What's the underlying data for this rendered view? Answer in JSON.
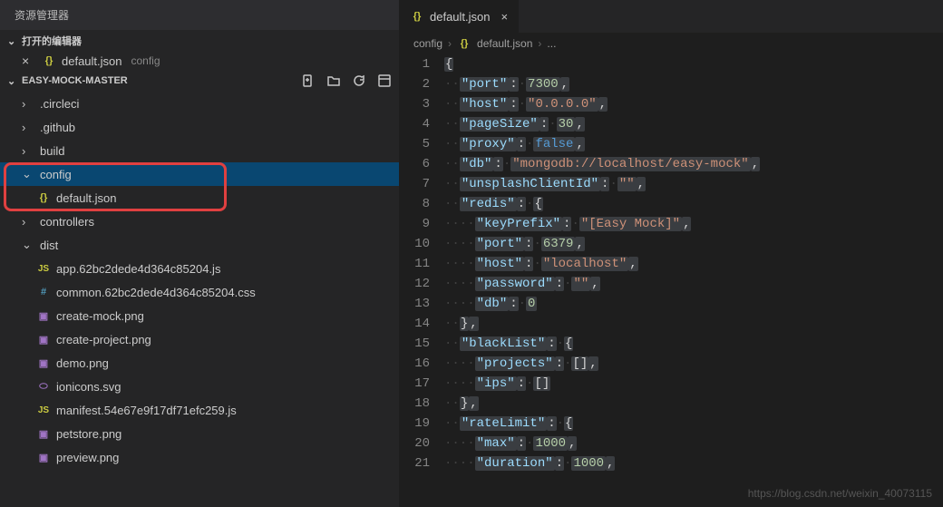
{
  "explorer": {
    "title": "资源管理器",
    "open_editors_label": "打开的编辑器",
    "open_editor": {
      "filename": "default.json",
      "path": "config"
    },
    "project_name": "EASY-MOCK-MASTER",
    "tree": [
      {
        "type": "folder",
        "name": ".circleci",
        "expanded": false,
        "indent": 1
      },
      {
        "type": "folder",
        "name": ".github",
        "expanded": false,
        "indent": 1
      },
      {
        "type": "folder",
        "name": "build",
        "expanded": false,
        "indent": 1
      },
      {
        "type": "folder",
        "name": "config",
        "expanded": true,
        "indent": 1,
        "selected": true,
        "highlight": true
      },
      {
        "type": "file",
        "name": "default.json",
        "icon": "json",
        "indent": 2,
        "highlight_child": true
      },
      {
        "type": "folder",
        "name": "controllers",
        "expanded": false,
        "indent": 1
      },
      {
        "type": "folder",
        "name": "dist",
        "expanded": true,
        "indent": 1
      },
      {
        "type": "file",
        "name": "app.62bc2dede4d364c85204.js",
        "icon": "js",
        "indent": 2
      },
      {
        "type": "file",
        "name": "common.62bc2dede4d364c85204.css",
        "icon": "css",
        "indent": 2
      },
      {
        "type": "file",
        "name": "create-mock.png",
        "icon": "img",
        "indent": 2
      },
      {
        "type": "file",
        "name": "create-project.png",
        "icon": "img",
        "indent": 2
      },
      {
        "type": "file",
        "name": "demo.png",
        "icon": "img",
        "indent": 2
      },
      {
        "type": "file",
        "name": "ionicons.svg",
        "icon": "svg",
        "indent": 2
      },
      {
        "type": "file",
        "name": "manifest.54e67e9f17df71efc259.js",
        "icon": "js",
        "indent": 2
      },
      {
        "type": "file",
        "name": "petstore.png",
        "icon": "img",
        "indent": 2
      },
      {
        "type": "file",
        "name": "preview.png",
        "icon": "img",
        "indent": 2
      }
    ]
  },
  "editor": {
    "tab_label": "default.json",
    "breadcrumb": [
      "config",
      "default.json",
      "..."
    ],
    "lines": [
      {
        "n": 1,
        "tokens": [
          [
            "brace",
            "{"
          ]
        ]
      },
      {
        "n": 2,
        "tokens": [
          [
            "indent",
            1
          ],
          [
            "key",
            "\"port\""
          ],
          [
            "punct",
            ":"
          ],
          [
            "sp"
          ],
          [
            "number",
            "7300"
          ],
          [
            "punct",
            ","
          ]
        ]
      },
      {
        "n": 3,
        "tokens": [
          [
            "indent",
            1
          ],
          [
            "key",
            "\"host\""
          ],
          [
            "punct",
            ":"
          ],
          [
            "sp"
          ],
          [
            "string",
            "\"0.0.0.0\""
          ],
          [
            "punct",
            ","
          ]
        ]
      },
      {
        "n": 4,
        "tokens": [
          [
            "indent",
            1
          ],
          [
            "key",
            "\"pageSize\""
          ],
          [
            "punct",
            ":"
          ],
          [
            "sp"
          ],
          [
            "number",
            "30"
          ],
          [
            "punct",
            ","
          ]
        ]
      },
      {
        "n": 5,
        "tokens": [
          [
            "indent",
            1
          ],
          [
            "key",
            "\"proxy\""
          ],
          [
            "punct",
            ":"
          ],
          [
            "sp"
          ],
          [
            "bool",
            "false"
          ],
          [
            "punct",
            ","
          ]
        ]
      },
      {
        "n": 6,
        "tokens": [
          [
            "indent",
            1
          ],
          [
            "key",
            "\"db\""
          ],
          [
            "punct",
            ":"
          ],
          [
            "sp"
          ],
          [
            "string",
            "\"mongodb://localhost/easy-mock\""
          ],
          [
            "punct",
            ","
          ]
        ]
      },
      {
        "n": 7,
        "tokens": [
          [
            "indent",
            1
          ],
          [
            "key",
            "\"unsplashClientId\""
          ],
          [
            "punct",
            ":"
          ],
          [
            "sp"
          ],
          [
            "string",
            "\"\""
          ],
          [
            "punct",
            ","
          ]
        ]
      },
      {
        "n": 8,
        "tokens": [
          [
            "indent",
            1
          ],
          [
            "key",
            "\"redis\""
          ],
          [
            "punct",
            ":"
          ],
          [
            "sp"
          ],
          [
            "brace",
            "{"
          ]
        ]
      },
      {
        "n": 9,
        "tokens": [
          [
            "indent",
            2
          ],
          [
            "key",
            "\"keyPrefix\""
          ],
          [
            "punct",
            ":"
          ],
          [
            "sp"
          ],
          [
            "string",
            "\"[Easy Mock]\""
          ],
          [
            "punct",
            ","
          ]
        ]
      },
      {
        "n": 10,
        "tokens": [
          [
            "indent",
            2
          ],
          [
            "key",
            "\"port\""
          ],
          [
            "punct",
            ":"
          ],
          [
            "sp"
          ],
          [
            "number",
            "6379"
          ],
          [
            "punct",
            ","
          ]
        ]
      },
      {
        "n": 11,
        "tokens": [
          [
            "indent",
            2
          ],
          [
            "key",
            "\"host\""
          ],
          [
            "punct",
            ":"
          ],
          [
            "sp"
          ],
          [
            "string",
            "\"localhost\""
          ],
          [
            "punct",
            ","
          ]
        ]
      },
      {
        "n": 12,
        "tokens": [
          [
            "indent",
            2
          ],
          [
            "key",
            "\"password\""
          ],
          [
            "punct",
            ":"
          ],
          [
            "sp"
          ],
          [
            "string",
            "\"\""
          ],
          [
            "punct",
            ","
          ]
        ]
      },
      {
        "n": 13,
        "tokens": [
          [
            "indent",
            2
          ],
          [
            "key",
            "\"db\""
          ],
          [
            "punct",
            ":"
          ],
          [
            "sp"
          ],
          [
            "number",
            "0"
          ]
        ]
      },
      {
        "n": 14,
        "tokens": [
          [
            "indent",
            1
          ],
          [
            "brace",
            "}"
          ],
          [
            "punct",
            ","
          ]
        ]
      },
      {
        "n": 15,
        "tokens": [
          [
            "indent",
            1
          ],
          [
            "key",
            "\"blackList\""
          ],
          [
            "punct",
            ":"
          ],
          [
            "sp"
          ],
          [
            "brace",
            "{"
          ]
        ]
      },
      {
        "n": 16,
        "tokens": [
          [
            "indent",
            2
          ],
          [
            "key",
            "\"projects\""
          ],
          [
            "punct",
            ":"
          ],
          [
            "sp"
          ],
          [
            "punct",
            "[]"
          ],
          [
            "punct",
            ","
          ]
        ]
      },
      {
        "n": 17,
        "tokens": [
          [
            "indent",
            2
          ],
          [
            "key",
            "\"ips\""
          ],
          [
            "punct",
            ":"
          ],
          [
            "sp"
          ],
          [
            "punct",
            "[]"
          ]
        ]
      },
      {
        "n": 18,
        "tokens": [
          [
            "indent",
            1
          ],
          [
            "brace",
            "}"
          ],
          [
            "punct",
            ","
          ]
        ]
      },
      {
        "n": 19,
        "tokens": [
          [
            "indent",
            1
          ],
          [
            "key",
            "\"rateLimit\""
          ],
          [
            "punct",
            ":"
          ],
          [
            "sp"
          ],
          [
            "brace",
            "{"
          ]
        ]
      },
      {
        "n": 20,
        "tokens": [
          [
            "indent",
            2
          ],
          [
            "key",
            "\"max\""
          ],
          [
            "punct",
            ":"
          ],
          [
            "sp"
          ],
          [
            "number",
            "1000"
          ],
          [
            "punct",
            ","
          ]
        ]
      },
      {
        "n": 21,
        "tokens": [
          [
            "indent",
            2
          ],
          [
            "key",
            "\"duration\""
          ],
          [
            "punct",
            ":"
          ],
          [
            "sp"
          ],
          [
            "number",
            "1000"
          ],
          [
            "punct",
            ","
          ]
        ]
      }
    ]
  },
  "watermark": "https://blog.csdn.net/weixin_40073115"
}
